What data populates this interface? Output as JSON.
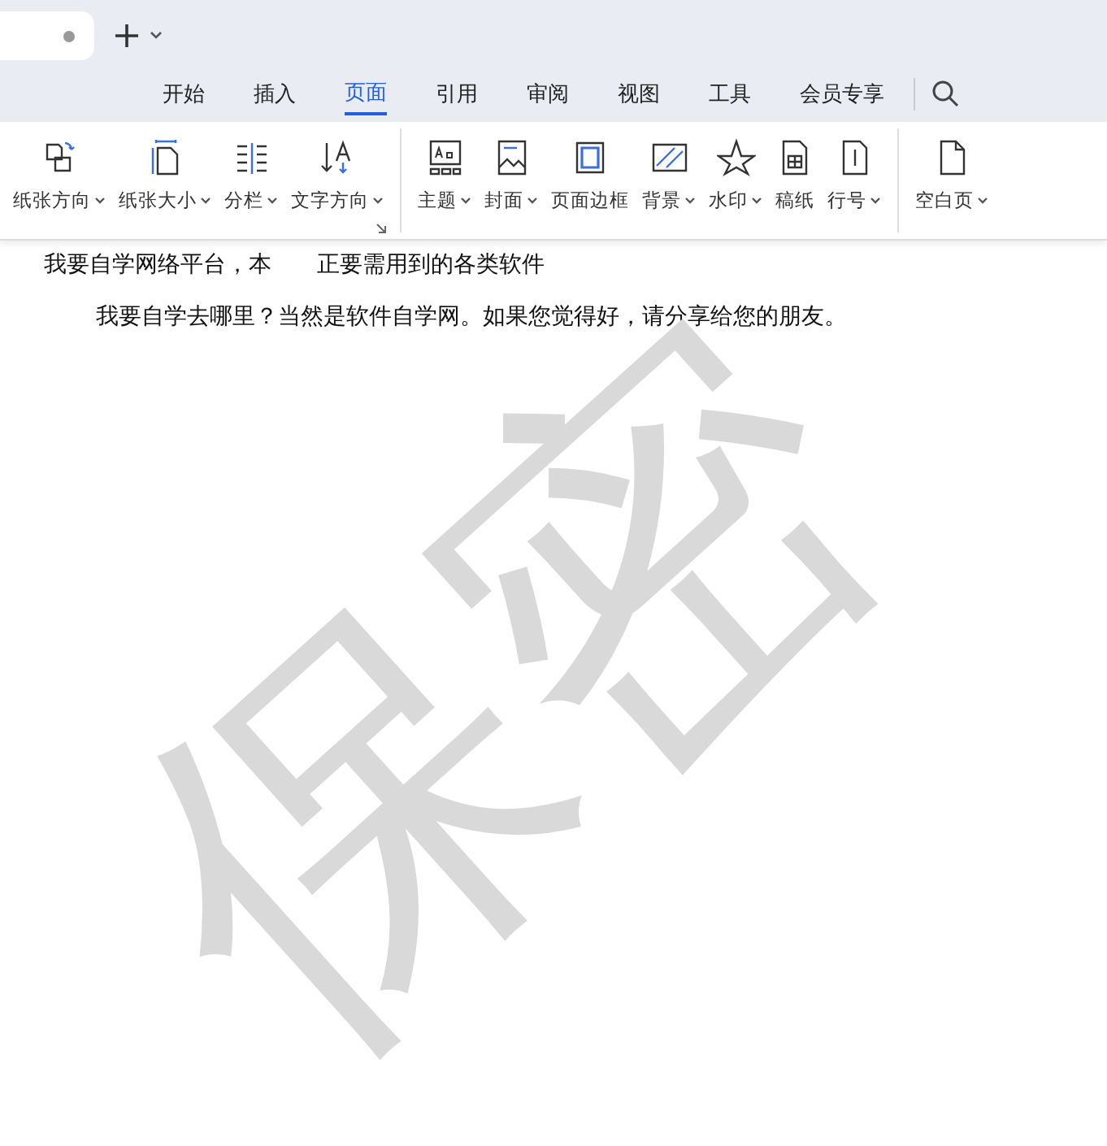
{
  "menu": [
    {
      "label": "开始",
      "selected": false
    },
    {
      "label": "插入",
      "selected": false
    },
    {
      "label": "页面",
      "selected": true
    },
    {
      "label": "引用",
      "selected": false
    },
    {
      "label": "审阅",
      "selected": false
    },
    {
      "label": "视图",
      "selected": false
    },
    {
      "label": "工具",
      "selected": false
    },
    {
      "label": "会员专享",
      "selected": false
    }
  ],
  "ribbon_groups": [
    [
      {
        "kind": "orientation",
        "label": "纸张方向",
        "dropdown": true
      },
      {
        "kind": "size",
        "label": "纸张大小",
        "dropdown": true
      },
      {
        "kind": "columns",
        "label": "分栏",
        "dropdown": true
      },
      {
        "kind": "direction",
        "label": "文字方向",
        "dropdown": true
      }
    ],
    [
      {
        "kind": "theme",
        "label": "主题",
        "dropdown": true
      },
      {
        "kind": "cover",
        "label": "封面",
        "dropdown": true
      },
      {
        "kind": "border",
        "label": "页面边框",
        "dropdown": false
      },
      {
        "kind": "background",
        "label": "背景",
        "dropdown": true
      },
      {
        "kind": "watermark",
        "label": "水印",
        "dropdown": true
      },
      {
        "kind": "grid",
        "label": "稿纸",
        "dropdown": false
      },
      {
        "kind": "linenum",
        "label": "行号",
        "dropdown": true
      }
    ],
    [
      {
        "kind": "blank",
        "label": "空白页",
        "dropdown": true
      }
    ]
  ],
  "document": {
    "lines": [
      {
        "parts": [
          "我要自学网络平台，本",
          "正要需用到的各类软件"
        ],
        "indent": false
      },
      {
        "parts": [
          "我要自学去哪里？当然是软件自学网。如果您觉得好，请分享给您的朋友。"
        ],
        "indent": true
      }
    ],
    "watermark": "保密"
  }
}
